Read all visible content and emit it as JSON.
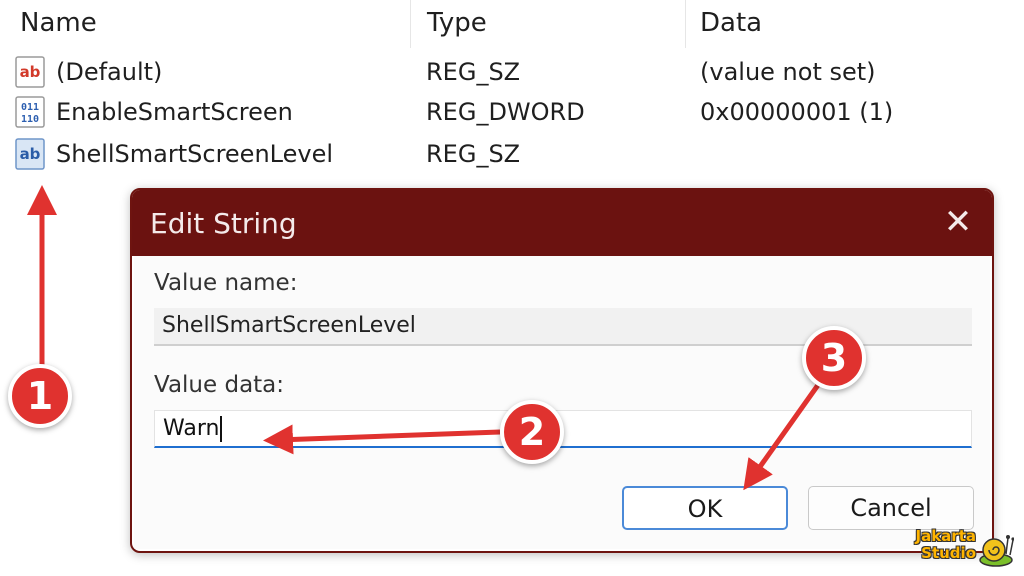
{
  "columns": {
    "name": "Name",
    "type": "Type",
    "data": "Data"
  },
  "rows": [
    {
      "icon": "string-value-icon",
      "name": "(Default)",
      "type": "REG_SZ",
      "data": "(value not set)"
    },
    {
      "icon": "binary-value-icon",
      "name": "EnableSmartScreen",
      "type": "REG_DWORD",
      "data": "0x00000001 (1)"
    },
    {
      "icon": "string-value-icon",
      "name": "ShellSmartScreenLevel",
      "type": "REG_SZ",
      "data": ""
    }
  ],
  "dialog": {
    "title": "Edit String",
    "close_glyph": "✕",
    "value_name_label": "Value name:",
    "value_name": "ShellSmartScreenLevel",
    "value_data_label": "Value data:",
    "value_data": "Warn",
    "ok_label": "OK",
    "cancel_label": "Cancel"
  },
  "annotations": {
    "step_1": "1",
    "step_2": "2",
    "step_3": "3",
    "color": "#e0322f"
  },
  "watermark": {
    "line1": "Jakarta",
    "line2": "Studio"
  },
  "colors": {
    "titlebar": "#6b1210",
    "input_accent": "#1f6fd0",
    "ok_border": "#4b8ad8"
  }
}
